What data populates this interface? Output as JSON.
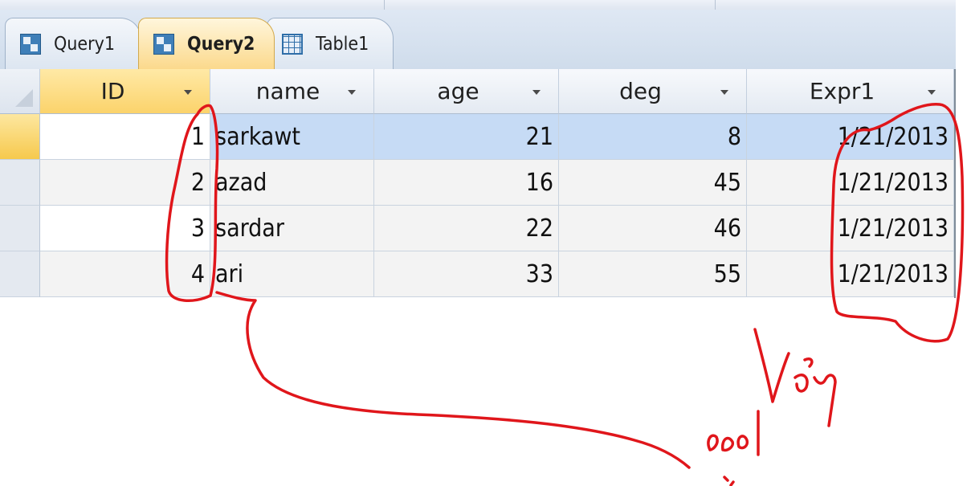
{
  "tabs": [
    {
      "label": "Query1",
      "icon": "query-icon",
      "active": false
    },
    {
      "label": "Query2",
      "icon": "query-icon",
      "active": true
    },
    {
      "label": "Table1",
      "icon": "table-icon",
      "active": false
    }
  ],
  "table": {
    "columns": [
      "ID",
      "name",
      "age",
      "deg",
      "Expr1"
    ],
    "rows": [
      {
        "id": "1",
        "name": "sarkawt",
        "age": "21",
        "deg": "8",
        "expr1": "1/21/2013"
      },
      {
        "id": "2",
        "name": "azad",
        "age": "16",
        "deg": "45",
        "expr1": "1/21/2013"
      },
      {
        "id": "3",
        "name": "sardar",
        "age": "22",
        "deg": "46",
        "expr1": "1/21/2013"
      },
      {
        "id": "4",
        "name": "ari",
        "age": "33",
        "deg": "55",
        "expr1": "1/21/2013"
      }
    ]
  },
  "colors": {
    "annotation": "#e0161b",
    "active_tab": "#fbd98c",
    "current_row": "#c6dbf5"
  }
}
